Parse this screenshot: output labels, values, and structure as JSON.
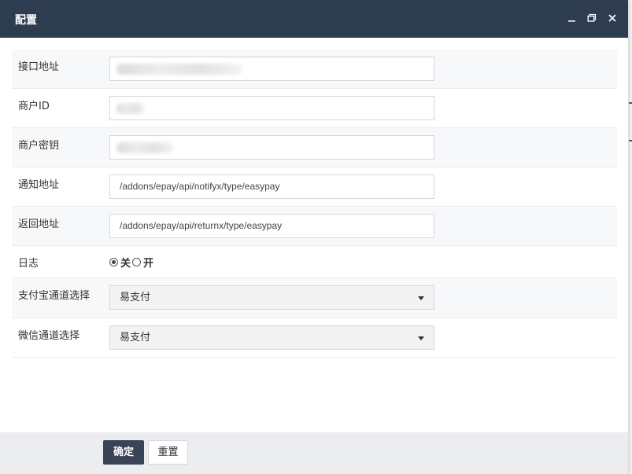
{
  "dialog": {
    "title": "配置",
    "icons": {
      "minimize": "minimize-icon",
      "maximize": "maximize-icon",
      "close": "close-icon"
    }
  },
  "form": {
    "api_url": {
      "label": "接口地址",
      "value": ""
    },
    "merchant_id": {
      "label": "商户ID",
      "value": ""
    },
    "merchant_key": {
      "label": "商户密钥",
      "value": ""
    },
    "notify_url": {
      "label": "通知地址",
      "value": "/addons/epay/api/notifyx/type/easypay"
    },
    "return_url": {
      "label": "返回地址",
      "value": "/addons/epay/api/returnx/type/easypay"
    },
    "log": {
      "label": "日志",
      "options": [
        {
          "label": "关",
          "checked": true
        },
        {
          "label": "开",
          "checked": false
        }
      ]
    },
    "alipay_channel": {
      "label": "支付宝通道选择",
      "selected": "易支付"
    },
    "wechat_channel": {
      "label": "微信通道选择",
      "selected": "易支付"
    }
  },
  "footer": {
    "confirm_label": "确定",
    "reset_label": "重置"
  },
  "colors": {
    "titlebar": "#2e3c50",
    "confirm_button": "#3a4459",
    "alt_row": "#f7f8f9"
  }
}
